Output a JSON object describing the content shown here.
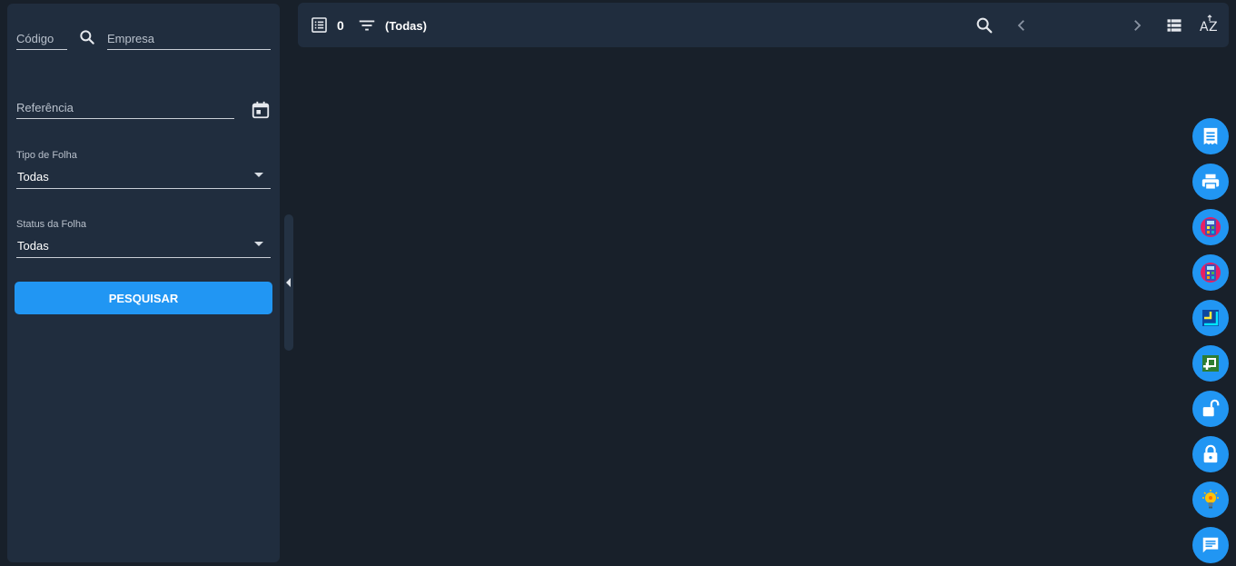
{
  "filters": {
    "codigo_label": "Código",
    "empresa_label": "Empresa",
    "referencia_label": "Referência",
    "tipo_folha": {
      "label": "Tipo de Folha",
      "value": "Todas"
    },
    "status_folha": {
      "label": "Status da Folha",
      "value": "Todas"
    },
    "search_button": "PESQUISAR"
  },
  "toolbar": {
    "count": "0",
    "filter_text": "(Todas)"
  },
  "fab_icons": [
    "document-list-icon",
    "print-icon",
    "calculator-icon",
    "calculator-icon",
    "crop-icon",
    "add-box-icon",
    "lock-open-icon",
    "lock-icon",
    "lightbulb-icon",
    "chat-icon"
  ],
  "colors": {
    "accent": "#2196f3",
    "panel": "#202d3e",
    "background": "#18202a"
  }
}
